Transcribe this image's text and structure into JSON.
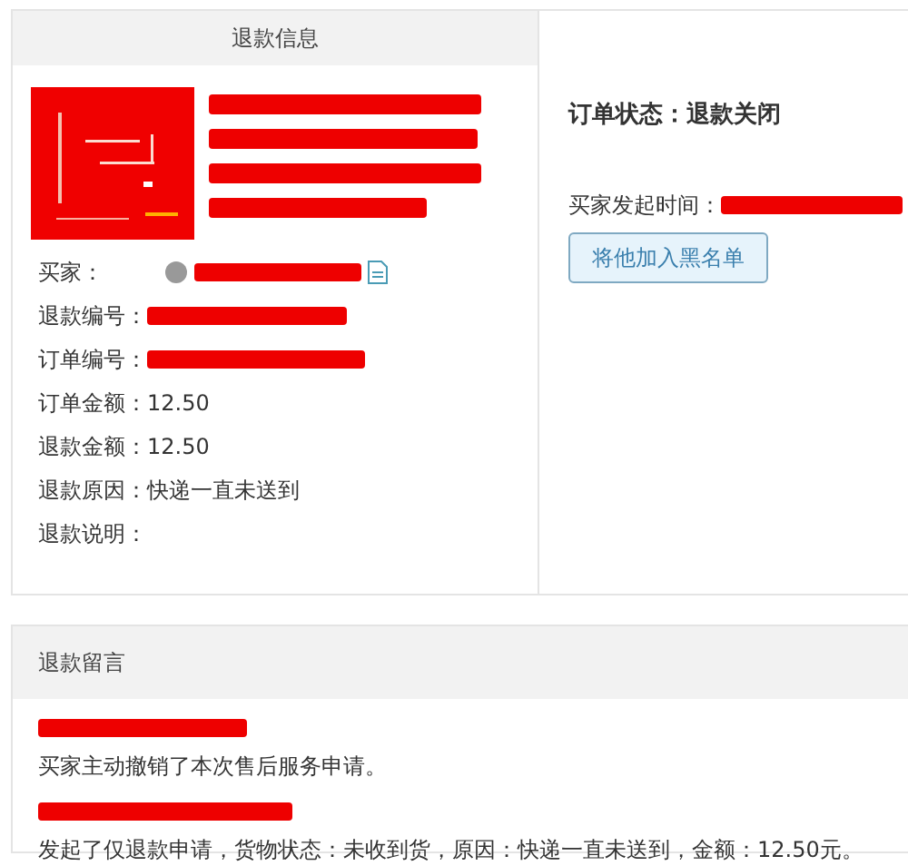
{
  "refund_info": {
    "title": "退款信息",
    "product": {
      "kind": "picture",
      "title_redacted": true
    },
    "buyer": {
      "label": "买家：",
      "redacted": true
    },
    "fields": [
      {
        "label": "退款编号：",
        "redacted": true
      },
      {
        "label": "订单编号：",
        "redacted": true
      },
      {
        "label": "订单金额：",
        "value": "12.50"
      },
      {
        "label": "退款金额：",
        "value": "12.50"
      },
      {
        "label": "退款原因：",
        "value": "快递一直未送到"
      },
      {
        "label": "退款说明："
      }
    ]
  },
  "order": {
    "status": "订单状态：退款关闭",
    "time_label": "买家发起时间：",
    "time_redacted": true,
    "blacklist_button": "将他加入黑名单"
  },
  "messages": {
    "title": "退款留言",
    "items": [
      {
        "time_redacted": true,
        "text": "买家主动撤销了本次售后服务申请。"
      },
      {
        "time_redacted": true,
        "text": "发起了仅退款申请，货物状态：未收到货，原因：快递一直未送到，金额：12.50元。"
      }
    ]
  }
}
